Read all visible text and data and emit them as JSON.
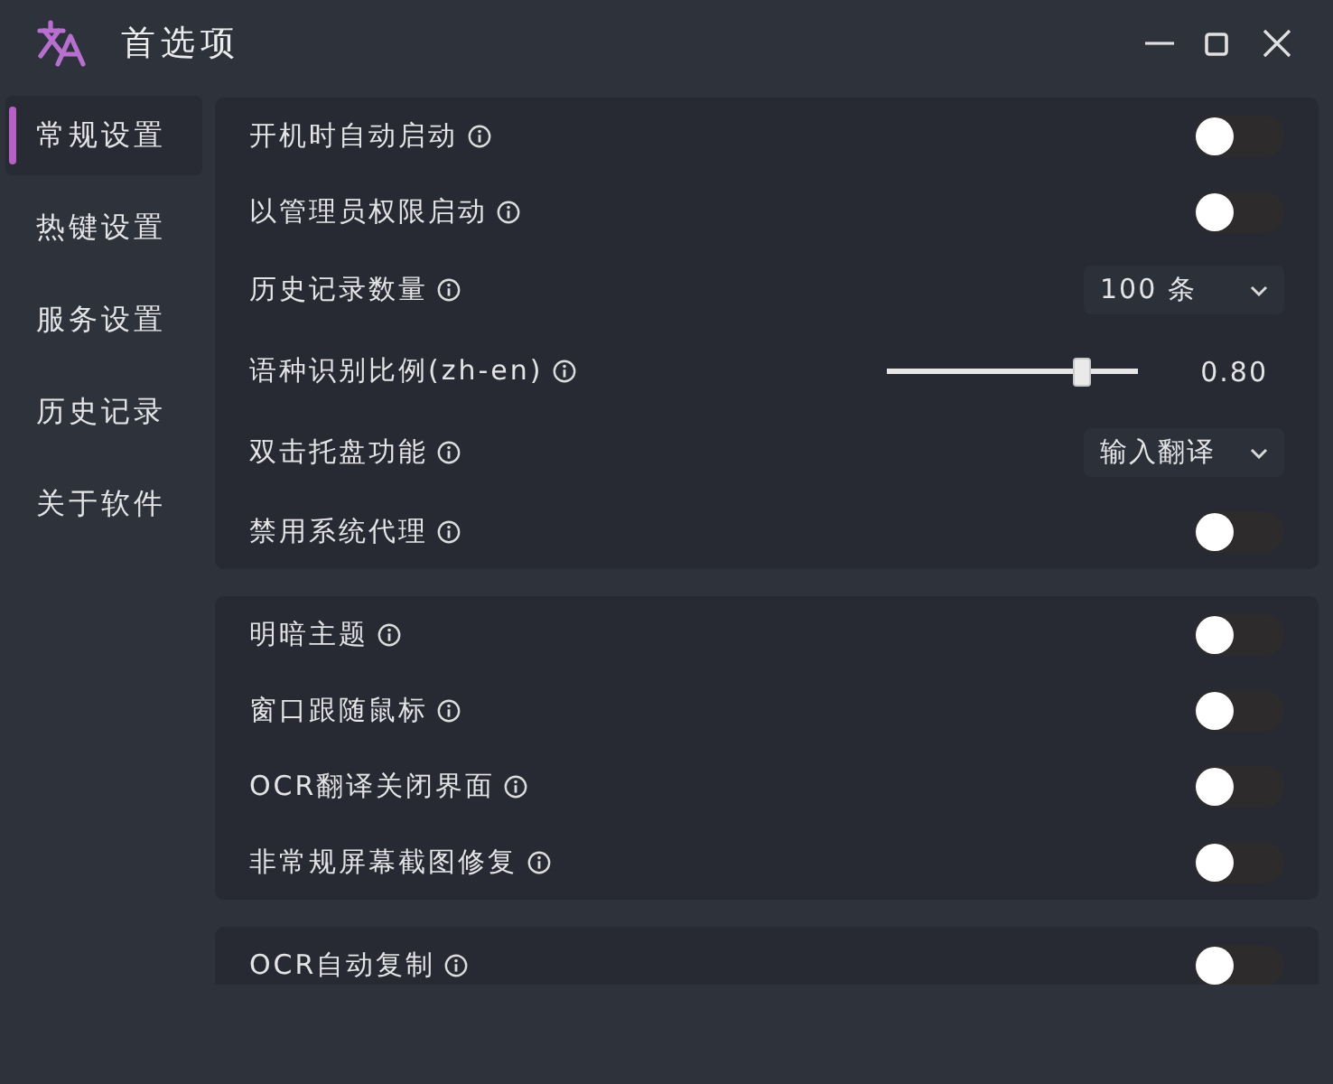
{
  "window": {
    "title": "首选项"
  },
  "sidebar": {
    "items": [
      {
        "label": "常规设置",
        "selected": true
      },
      {
        "label": "热键设置",
        "selected": false
      },
      {
        "label": "服务设置",
        "selected": false
      },
      {
        "label": "历史记录",
        "selected": false
      },
      {
        "label": "关于软件",
        "selected": false
      }
    ]
  },
  "sections": [
    {
      "rows": [
        {
          "kind": "toggle",
          "label": "开机时自动启动",
          "on": false
        },
        {
          "kind": "toggle",
          "label": "以管理员权限启动",
          "on": false
        },
        {
          "kind": "select",
          "label": "历史记录数量",
          "value": "100 条"
        },
        {
          "kind": "slider",
          "label": "语种识别比例(zh-en)",
          "level": 0.8,
          "reading": "0.80"
        },
        {
          "kind": "select",
          "label": "双击托盘功能",
          "value": "输入翻译"
        },
        {
          "kind": "toggle",
          "label": "禁用系统代理",
          "on": false
        }
      ]
    },
    {
      "rows": [
        {
          "kind": "toggle",
          "label": "明暗主题",
          "on": false
        },
        {
          "kind": "toggle",
          "label": "窗口跟随鼠标",
          "on": false
        },
        {
          "kind": "toggle",
          "label": "OCR翻译关闭界面",
          "on": false
        },
        {
          "kind": "toggle",
          "label": "非常规屏幕截图修复",
          "on": false
        }
      ]
    },
    {
      "rows": [
        {
          "kind": "toggle",
          "label": "OCR自动复制",
          "on": false
        }
      ]
    }
  ]
}
